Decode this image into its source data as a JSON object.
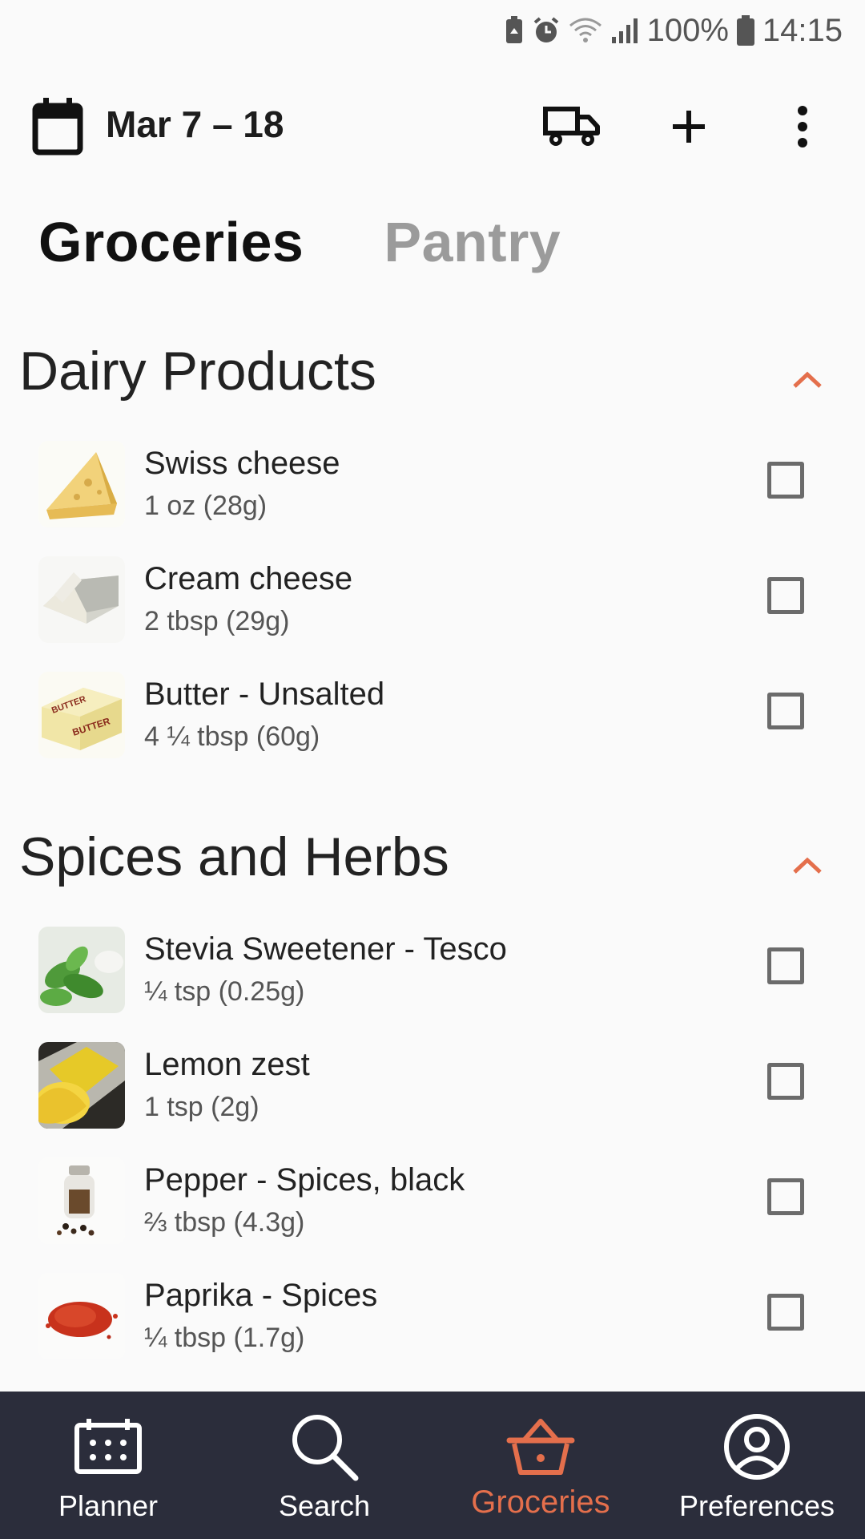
{
  "status_bar": {
    "battery_percent": "100%",
    "time": "14:15",
    "icons": [
      "battery-saver-icon",
      "alarm-icon",
      "wifi-icon",
      "signal-icon",
      "battery-icon"
    ]
  },
  "toolbar": {
    "date_range": "Mar 7 – 18",
    "icons": [
      "calendar-icon",
      "truck-icon",
      "plus-icon",
      "more-vert-icon"
    ]
  },
  "tabs": [
    {
      "label": "Groceries",
      "active": true
    },
    {
      "label": "Pantry",
      "active": false
    }
  ],
  "sections": [
    {
      "title": "Dairy Products",
      "items": [
        {
          "name": "Swiss cheese",
          "qty": "1 oz (28g)",
          "checked": false,
          "image": "swiss-cheese"
        },
        {
          "name": "Cream cheese",
          "qty": "2 tbsp (29g)",
          "checked": false,
          "image": "cream-cheese"
        },
        {
          "name": "Butter - Unsalted",
          "qty": "4 ¼ tbsp (60g)",
          "checked": false,
          "image": "butter",
          "image_text": "BUTTER"
        }
      ]
    },
    {
      "title": "Spices and Herbs",
      "items": [
        {
          "name": "Stevia Sweetener - Tesco",
          "qty": "¼ tsp (0.25g)",
          "checked": false,
          "image": "stevia"
        },
        {
          "name": "Lemon zest",
          "qty": "1 tsp (2g)",
          "checked": false,
          "image": "lemon-zest"
        },
        {
          "name": "Pepper - Spices, black",
          "qty": "⅔ tbsp (4.3g)",
          "checked": false,
          "image": "pepper"
        },
        {
          "name": "Paprika - Spices",
          "qty": "¼ tbsp (1.7g)",
          "checked": false,
          "image": "paprika"
        }
      ]
    }
  ],
  "bottom_nav": [
    {
      "label": "Planner",
      "icon": "planner-icon",
      "active": false
    },
    {
      "label": "Search",
      "icon": "search-icon",
      "active": false
    },
    {
      "label": "Groceries",
      "icon": "basket-icon",
      "active": true
    },
    {
      "label": "Preferences",
      "icon": "profile-icon",
      "active": false
    }
  ],
  "colors": {
    "accent": "#e46f4c",
    "nav_background": "#2b2d3b",
    "background": "#fafafa",
    "inactive_tab": "#9b9b9b"
  }
}
